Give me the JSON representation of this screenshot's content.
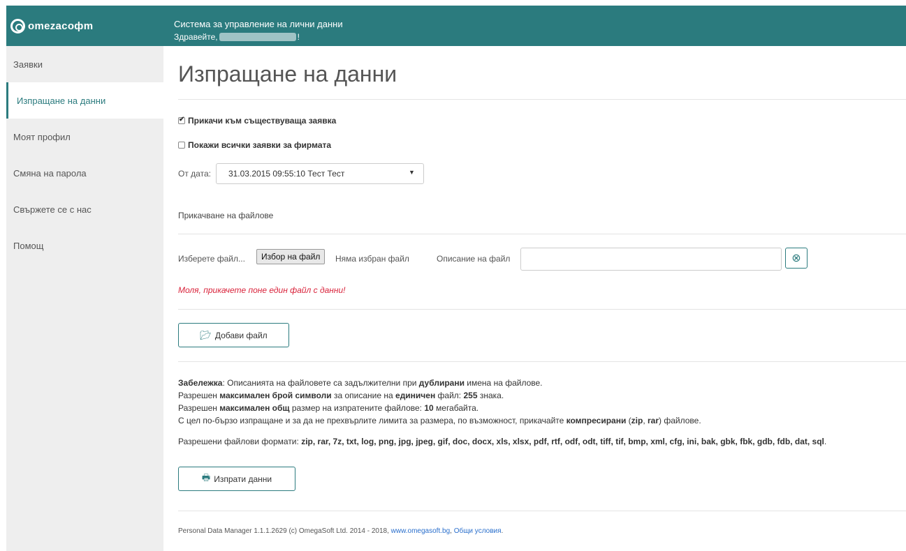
{
  "header": {
    "logo_text": "omezacoфm",
    "system_title": "Система за управление на лични данни",
    "greeting_prefix": "Здравейте,",
    "greeting_suffix": "!"
  },
  "sidebar": {
    "items": [
      {
        "label": "Заявки"
      },
      {
        "label": "Изпращане на данни"
      },
      {
        "label": "Моят профил"
      },
      {
        "label": "Смяна на парола"
      },
      {
        "label": "Свържете се с нас"
      },
      {
        "label": "Помощ"
      }
    ],
    "active_index": 1
  },
  "main": {
    "title": "Изпращане на данни",
    "attach_existing_label": "Прикачи към съществуваща заявка",
    "attach_existing_checked": true,
    "show_all_label": "Покажи всички заявки за фирмата",
    "show_all_checked": false,
    "from_date_label": "От дата:",
    "from_date_value": "31.03.2015 09:55:10 Тест Тест",
    "attach_files_label": "Прикачване на файлове",
    "choose_file_label": "Изберете файл...",
    "choose_file_button": "Избор на файл",
    "no_file_label": "Няма избран файл",
    "file_description_label": "Описание на файл",
    "file_description_value": "",
    "error_message": "Моля, прикачете поне един файл с данни!",
    "add_file_button": "Добави файл",
    "send_button": "Изпрати данни"
  },
  "notes": {
    "line1_a": "Забележка",
    "line1_b": ": Описанията на файловете са задължителни при ",
    "line1_c": "дублирани",
    "line1_d": " имена на файлове.",
    "line2_a": "Разрешен ",
    "line2_b": "максимален брой символи",
    "line2_c": " за описание на ",
    "line2_d": "единичен",
    "line2_e": " файл: ",
    "line2_f": "255",
    "line2_g": " знака.",
    "line3_a": "Разрешен ",
    "line3_b": "максимален общ",
    "line3_c": " размер на изпратените файлове: ",
    "line3_d": "10",
    "line3_e": " мегабайта.",
    "line4_a": "С цел по-бързо изпращане и за да не прехвърлите лимита за размера, по възможност, прикачайте ",
    "line4_b": "компресирани",
    "line4_c": " (",
    "line4_d": "zip",
    "line4_e": ", ",
    "line4_f": "rar",
    "line4_g": ") файлове.",
    "formats_label": "Разрешени файлови формати: ",
    "formats_list": "zip, rar, 7z, txt, log, png, jpg, jpeg, gif, doc, docx, xls, xlsx, pdf, rtf, odf, odt, tiff, tif, bmp, xml, cfg, ini, bak, gbk, fbk, gdb, fdb, dat, sql",
    "formats_end": "."
  },
  "footer": {
    "text": "Personal Data Manager 1.1.1.2629 (c) OmegaSoft Ltd. 2014 - 2018, ",
    "link1": "www.omegasoft.bg",
    "sep": ", ",
    "link2": "Общи условия",
    "end": "."
  }
}
